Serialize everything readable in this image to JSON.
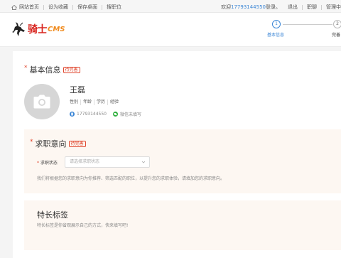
{
  "topbar": {
    "links": [
      "网站首页",
      "设为收藏",
      "保存桌面",
      "搜职位"
    ],
    "welcome": "欢迎",
    "phone": "17793144550",
    "logged_in": "登录。",
    "logout": "退出",
    "jobs": "职聊",
    "manage": "管理中"
  },
  "logo": {
    "text": "骑士",
    "cms": "CMS"
  },
  "steps": [
    {
      "num": "1",
      "label": "基本信息"
    },
    {
      "num": "2",
      "label": "完善"
    }
  ],
  "basic": {
    "title": "基本信息",
    "badge": "待完善",
    "name": "王磊",
    "tags": [
      "性别",
      "年龄",
      "学历",
      "经验"
    ],
    "phone": "17793144550",
    "wechat": "微信未填写"
  },
  "intent": {
    "title": "求职意向",
    "badge": "待完善",
    "field_label": "求职状态",
    "select_placeholder": "请选择求职状态",
    "hint": "我们将根据您的求职意向为你推荐、筛选匹配的职位，以提升您的求职体验，请填加您的求职意向。"
  },
  "skills": {
    "title": "特长标签",
    "hint": "特长标签是你省观展示自己的方式，快来填写吧!"
  },
  "colors": {
    "accent": "#3b86d6",
    "required": "#e0472e",
    "brand_red": "#d8251f",
    "brand_orange": "#f08b1e"
  }
}
